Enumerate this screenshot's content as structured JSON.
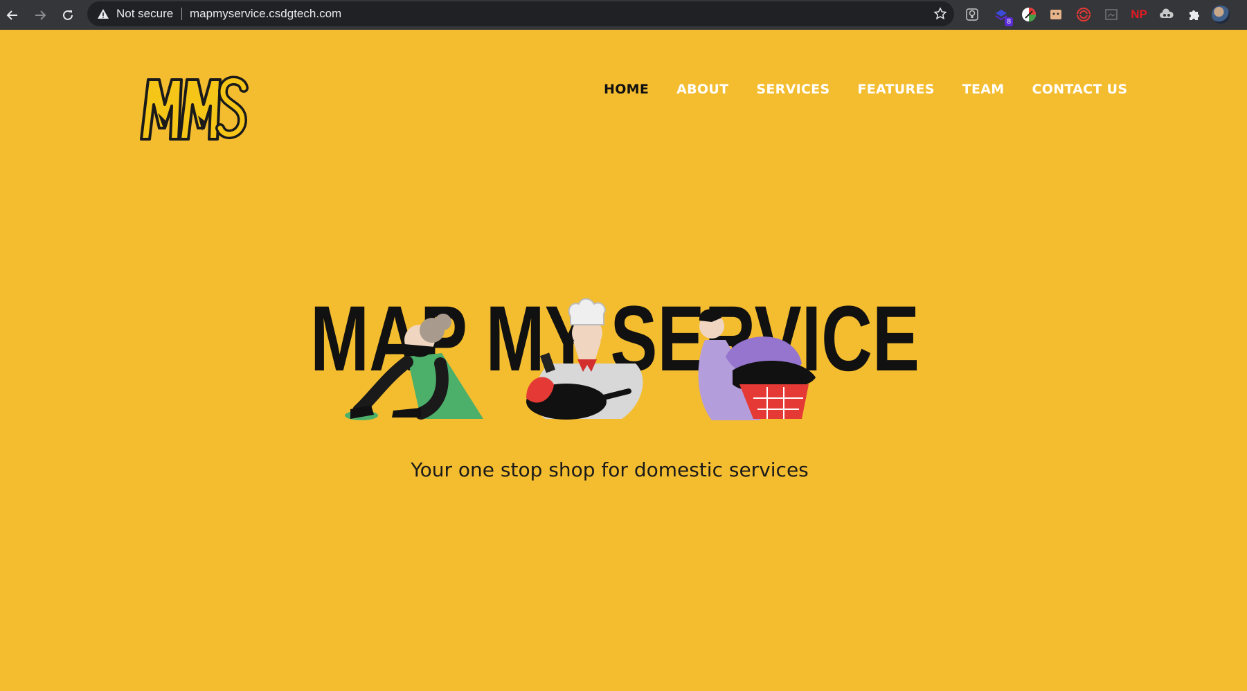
{
  "browser": {
    "security_label": "Not secure",
    "url": "mapmyservice.csdgtech.com",
    "extension_badge": "8",
    "np_extension_label": "NP"
  },
  "site": {
    "logo_text": "MMS",
    "nav": [
      {
        "label": "HOME",
        "active": true
      },
      {
        "label": "ABOUT"
      },
      {
        "label": "SERVICES"
      },
      {
        "label": "FEATURES"
      },
      {
        "label": "TEAM"
      },
      {
        "label": "CONTACT US"
      }
    ],
    "hero_title": "MAP MY SERVICE",
    "tagline": "Your one stop shop for domestic services"
  },
  "colors": {
    "page_bg": "#f4bd30",
    "nav_text": "#ffffff",
    "nav_active": "#111111",
    "hero_text": "#111111"
  }
}
